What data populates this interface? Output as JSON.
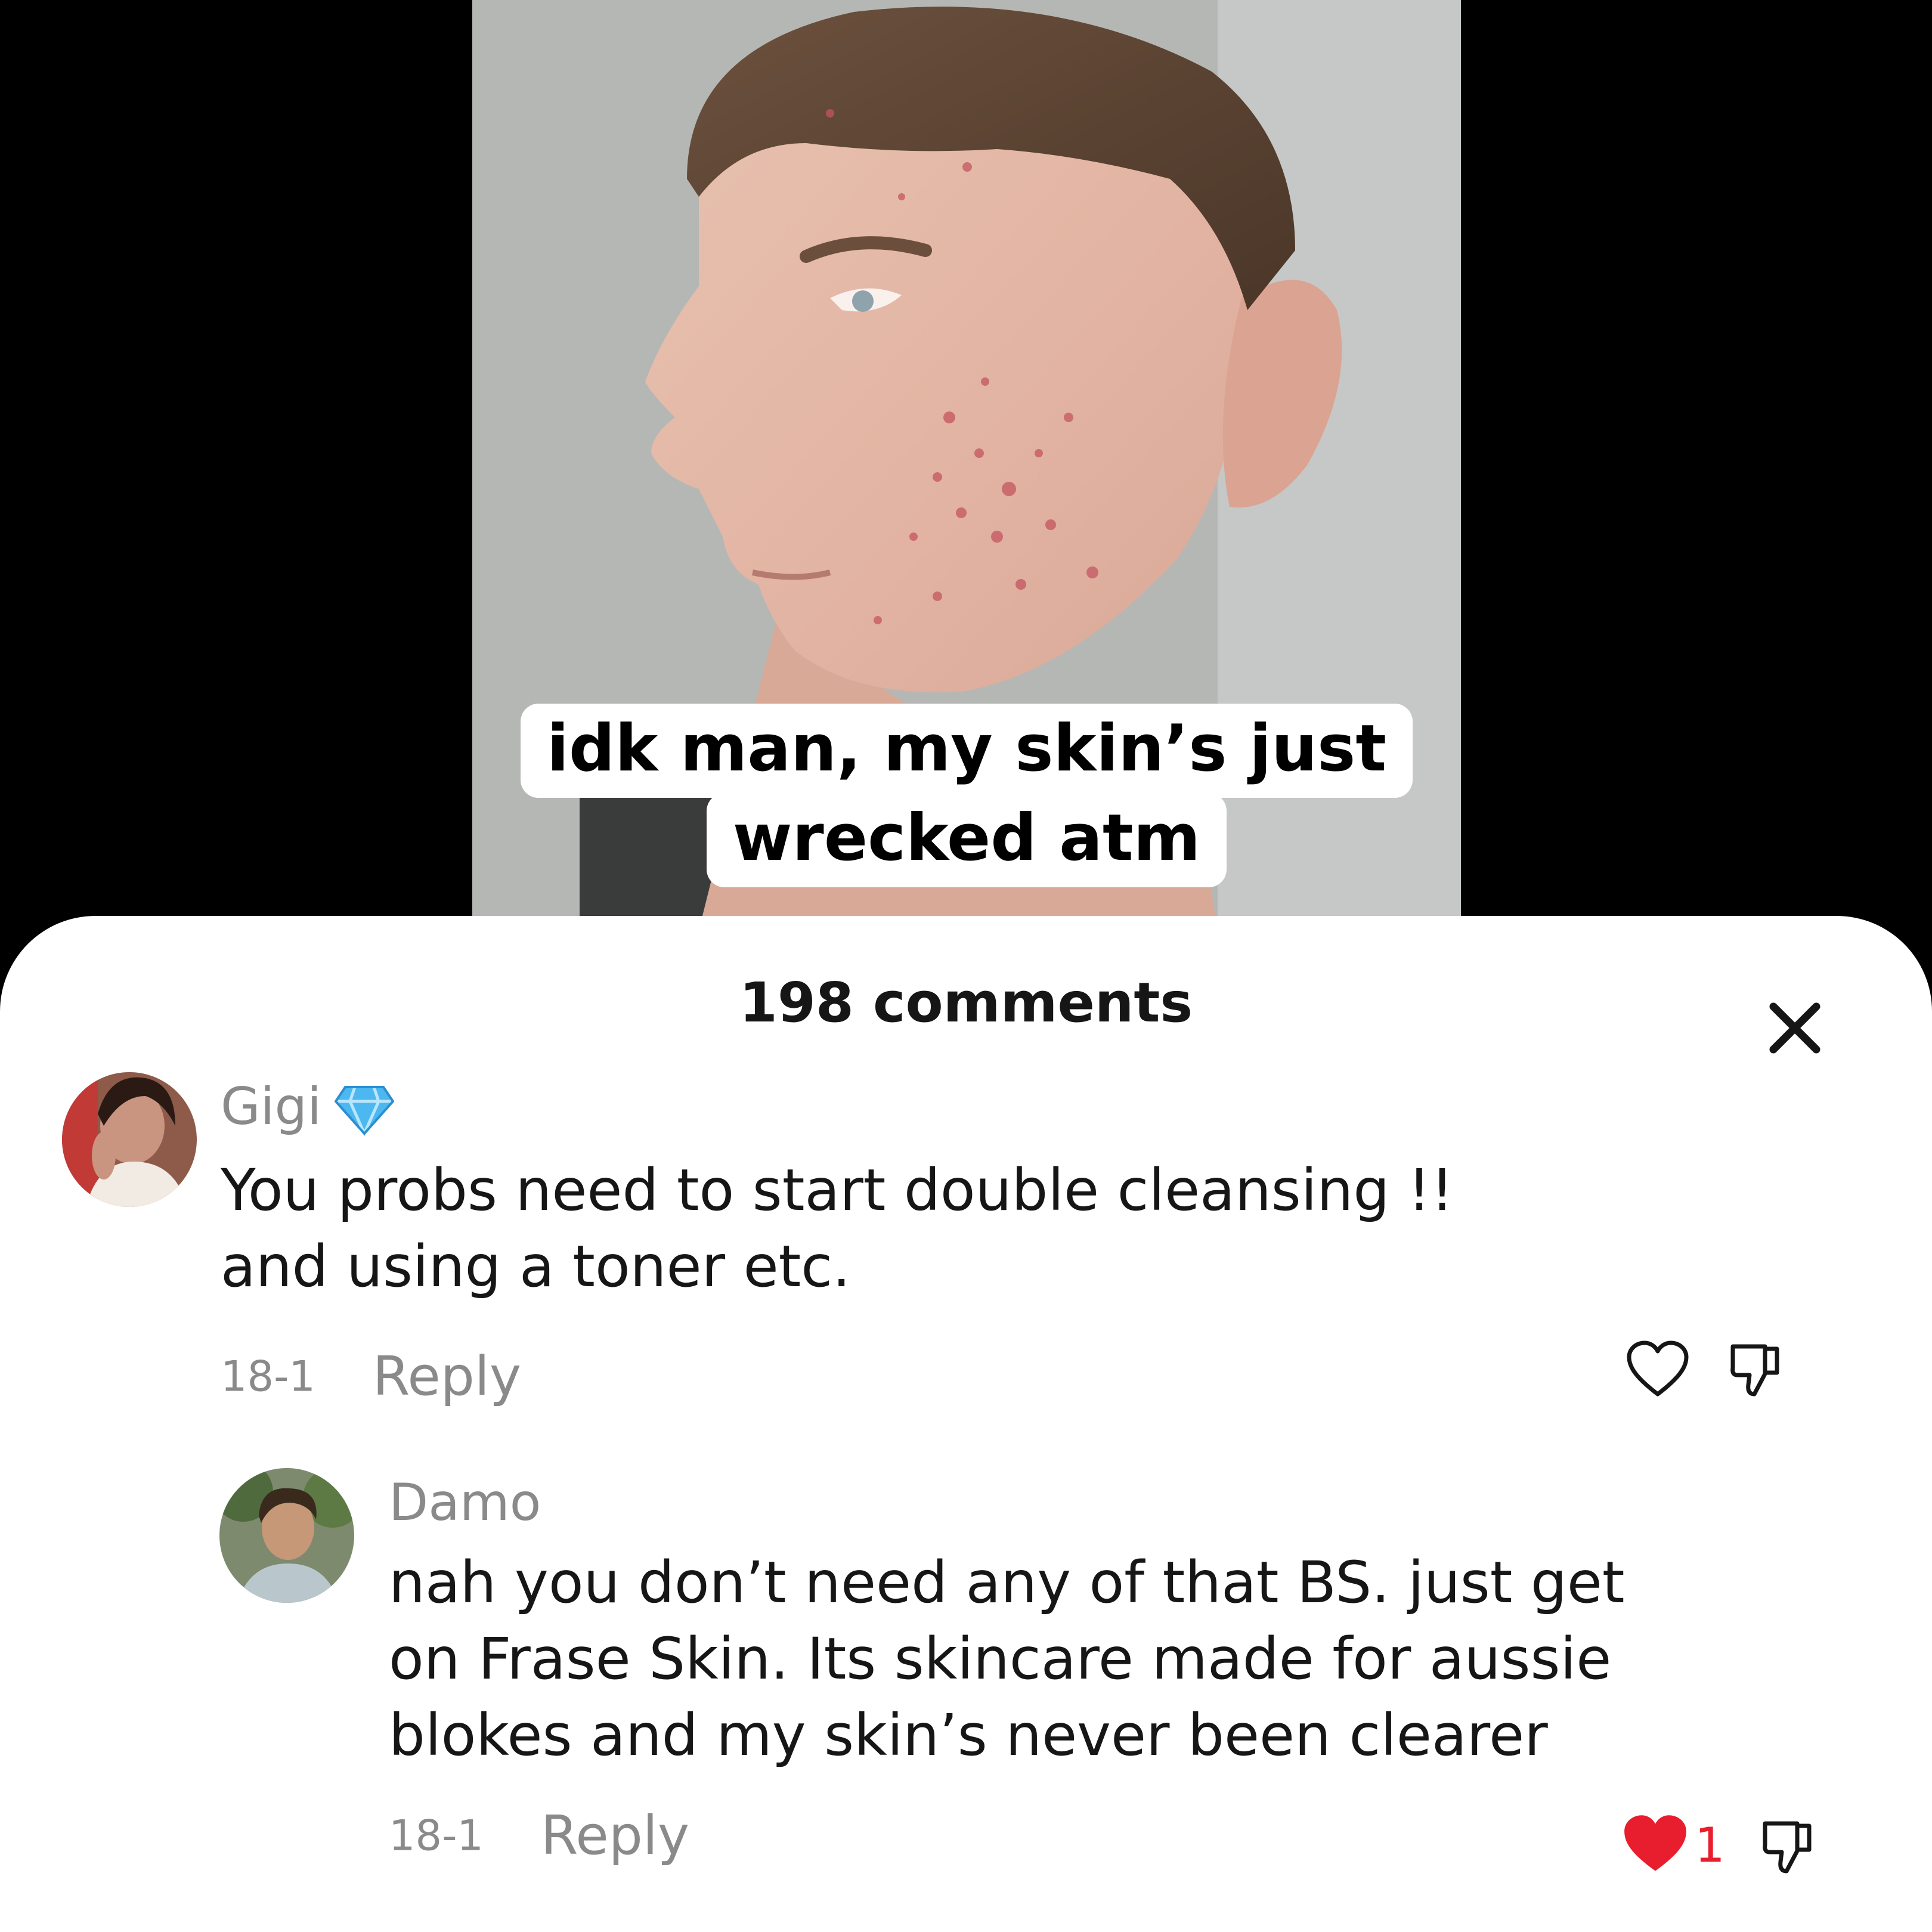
{
  "video": {
    "caption_line1": "idk man, my skin’s just",
    "caption_line2": "wrecked atm"
  },
  "comments_panel": {
    "title": "198 comments",
    "close_icon": "close-icon"
  },
  "comments": [
    {
      "username": "Gigi",
      "badge_icon": "diamond-icon",
      "text_line1": "You probs need to start double cleansing !!",
      "text_line2": "and using a toner etc.",
      "date": "18-1",
      "reply_label": "Reply",
      "liked": false
    },
    {
      "username": "Damo",
      "text_line1": "nah you don’t need any of that BS. just get",
      "text_line2": "on Frase Skin. Its skincare made for aussie",
      "text_line3": "blokes and my skin’s never been clearer",
      "date": "18-1",
      "reply_label": "Reply",
      "liked": true,
      "like_count": "1"
    }
  ],
  "colors": {
    "like_red": "#e81d2d",
    "muted_text": "#8a8a8a",
    "primary_text": "#161616",
    "badge_blue": "#4db8f0"
  }
}
